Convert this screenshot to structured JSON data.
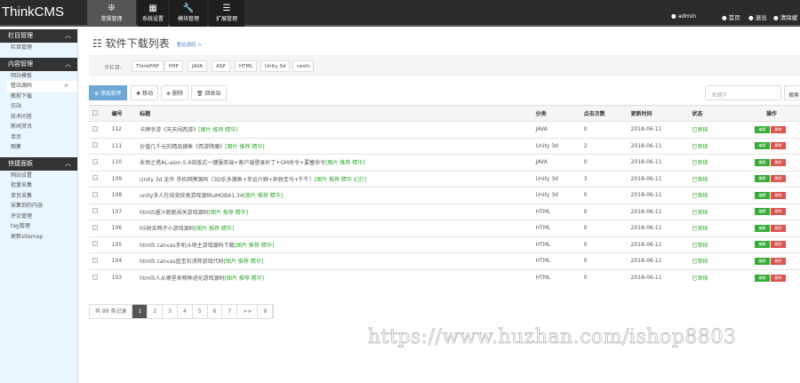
{
  "app": {
    "logo": "ThinkCMS"
  },
  "top_tabs": [
    {
      "label": "常规管理",
      "icon": "gear-icon"
    },
    {
      "label": "系统设置",
      "icon": "grid-icon"
    },
    {
      "label": "模块管理",
      "icon": "wrench-icon"
    },
    {
      "label": "扩展管理",
      "icon": "list-icon"
    }
  ],
  "top_right": {
    "user": "admin",
    "home": "首页",
    "logout": "退出",
    "clear": "清除缓"
  },
  "sidebar": {
    "groups": [
      {
        "title": "栏目管理",
        "items": [
          "栏目管理"
        ]
      },
      {
        "title": "内容管理",
        "items": [
          "网站模板",
          "整站源码",
          "教程下载",
          "仿站",
          "技术问答",
          "新闻资讯",
          "单页",
          "图集"
        ]
      },
      {
        "title": "快捷面板",
        "items": [
          "网站设置",
          "批量采集",
          "单页采集",
          "采集到的内容",
          "评论管理",
          "tag管理",
          "更新sitemap"
        ]
      }
    ],
    "active": "整站源码",
    "arrow": ">"
  },
  "page": {
    "title": "软件下载列表",
    "breadcrumb": "整站源码 >"
  },
  "subcats": {
    "label": "子栏目:",
    "items": [
      "ThinkPHP",
      "PHP",
      "JAVA",
      "ASP",
      "HTML",
      "Unity 3d",
      "ceshi"
    ]
  },
  "toolbar": {
    "add": "添加软件",
    "move": "移动",
    "delete": "删除",
    "recycle": "回收站"
  },
  "search": {
    "placeholder": "关键字",
    "button": "搜索"
  },
  "table": {
    "headers": [
      "编号",
      "标题",
      "分类",
      "点击次数",
      "更新时间",
      "状态",
      "操作"
    ],
    "edit": "编辑",
    "del": "删除",
    "rows": [
      {
        "id": "112",
        "title": "卡牌手游《天天闯西游》",
        "tags": "[图片 推荐 精华]",
        "cat": "JAVA",
        "clicks": "0",
        "date": "2018-06-11",
        "status": "已审核"
      },
      {
        "id": "111",
        "title": "价值几千元的精品捕鱼《西游降魔》",
        "tags": "[图片 推荐 精华]",
        "cat": "Unity 3d",
        "clicks": "2",
        "date": "2018-06-11",
        "status": "已审核"
      },
      {
        "id": "110",
        "title": "永恒之塔AL-aion-5.6倍版式一键服务端+客户端登录补丁+GM命令+要塞命令",
        "tags": "[图片 推荐 精华]",
        "cat": "JAVA",
        "clicks": "0",
        "date": "2018-06-11",
        "status": "已审核"
      },
      {
        "id": "109",
        "title": "Unity 3d 龙华 手机棋牌源码（3D乐多捕鱼+幸运六狮+奔驰宝马+牛牛）",
        "tags": "[图片 推荐 精华 幻灯]",
        "cat": "Unity 3d",
        "clicks": "3",
        "date": "2018-06-11",
        "status": "已审核"
      },
      {
        "id": "108",
        "title": "unity多人在线竞技类游戏源码uMOBA1.34",
        "tags": "[图片 推荐 精华]",
        "cat": "Unity 3d",
        "clicks": "0",
        "date": "2018-06-11",
        "status": "已审核"
      },
      {
        "id": "107",
        "title": "html5墨汁跑跑闯关游戏源码",
        "tags": "[图片 推荐 精华]",
        "cat": "HTML",
        "clicks": "0",
        "date": "2018-06-11",
        "status": "已审核"
      },
      {
        "id": "106",
        "title": "h5射击鸭子小游戏源码",
        "tags": "[图片 推荐 精华]",
        "cat": "HTML",
        "clicks": "0",
        "date": "2018-06-11",
        "status": "已审核"
      },
      {
        "id": "105",
        "title": "html5 canvas手机斗地主游戏源码下载",
        "tags": "[图片 推荐 精华]",
        "cat": "HTML",
        "clicks": "0",
        "date": "2018-06-11",
        "status": "已审核"
      },
      {
        "id": "104",
        "title": "html5 canvas蓝宝石消除游戏代码",
        "tags": "[图片 推荐 精华]",
        "cat": "HTML",
        "clicks": "0",
        "date": "2018-06-11",
        "status": "已审核"
      },
      {
        "id": "103",
        "title": "html5人从哪里来物种进化游戏源码",
        "tags": "[图片 推荐 精华]",
        "cat": "HTML",
        "clicks": "0",
        "date": "2018-06-11",
        "status": "已审核"
      }
    ]
  },
  "pager": {
    "total": "共 89 条记录",
    "pages": [
      "1",
      "2",
      "3",
      "4",
      "5",
      "6",
      "7",
      ">>",
      "9"
    ],
    "current": "1"
  },
  "watermark": "https://www.huzhan.com/ishop8803"
}
